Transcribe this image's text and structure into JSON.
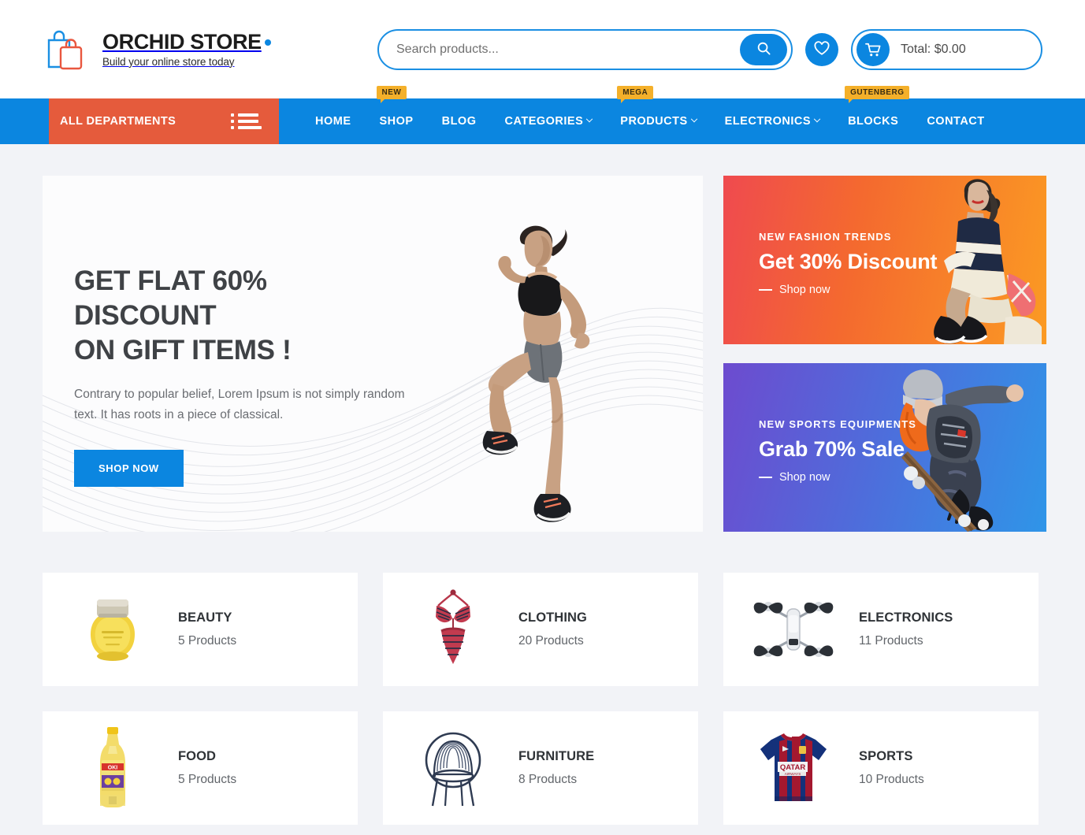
{
  "brand": {
    "title": "ORCHID STORE",
    "tagline": "Build your online store today",
    "logo_icon": "shopping-bag-icon",
    "accent_blue": "#0b86e0",
    "accent_orange": "#e55b3c"
  },
  "search": {
    "placeholder": "Search products...",
    "value": "",
    "button_icon": "search-icon"
  },
  "wishlist": {
    "icon": "heart-icon"
  },
  "cart": {
    "icon": "cart-icon",
    "total_label": "Total: $0.00"
  },
  "nav": {
    "departments_label": "ALL DEPARTMENTS",
    "departments_icon": "list-menu-icon",
    "items": [
      {
        "label": "HOME",
        "has_dropdown": false,
        "badge": ""
      },
      {
        "label": "SHOP",
        "has_dropdown": false,
        "badge": "NEW"
      },
      {
        "label": "BLOG",
        "has_dropdown": false,
        "badge": ""
      },
      {
        "label": "CATEGORIES",
        "has_dropdown": true,
        "badge": ""
      },
      {
        "label": "PRODUCTS",
        "has_dropdown": true,
        "badge": "MEGA"
      },
      {
        "label": "ELECTRONICS",
        "has_dropdown": true,
        "badge": ""
      },
      {
        "label": "BLOCKS",
        "has_dropdown": false,
        "badge": "GUTENBERG"
      },
      {
        "label": "CONTACT",
        "has_dropdown": false,
        "badge": ""
      }
    ]
  },
  "hero": {
    "title_line1": "GET FLAT 60% DISCOUNT",
    "title_line2": "ON GIFT ITEMS !",
    "subtitle": "Contrary to popular belief, Lorem Ipsum is not simply random text. It has roots in a piece of classical.",
    "button_label": "SHOP NOW",
    "image": "running-woman-photo"
  },
  "promos": [
    {
      "kicker": "NEW FASHION TRENDS",
      "title": "Get 30% Discount",
      "link_label": "Shop now",
      "image": "fashion-model-photo",
      "gradient_from": "#ef4a4f",
      "gradient_to": "#fb9a23"
    },
    {
      "kicker": "NEW SPORTS EQUIPMENTS",
      "title": "Grab 70% Sale",
      "link_label": "Shop now",
      "image": "skateboarder-photo",
      "gradient_from": "#6d4bcf",
      "gradient_to": "#2f95e8"
    }
  ],
  "categories": [
    {
      "name": "BEAUTY",
      "count": "5 Products",
      "image": "cream-jar-icon"
    },
    {
      "name": "CLOTHING",
      "count": "20 Products",
      "image": "bikini-icon"
    },
    {
      "name": "ELECTRONICS",
      "count": "11 Products",
      "image": "drone-icon"
    },
    {
      "name": "FOOD",
      "count": "5 Products",
      "image": "oil-bottle-icon"
    },
    {
      "name": "FURNITURE",
      "count": "8 Products",
      "image": "chair-icon"
    },
    {
      "name": "SPORTS",
      "count": "10 Products",
      "image": "jersey-icon"
    }
  ]
}
